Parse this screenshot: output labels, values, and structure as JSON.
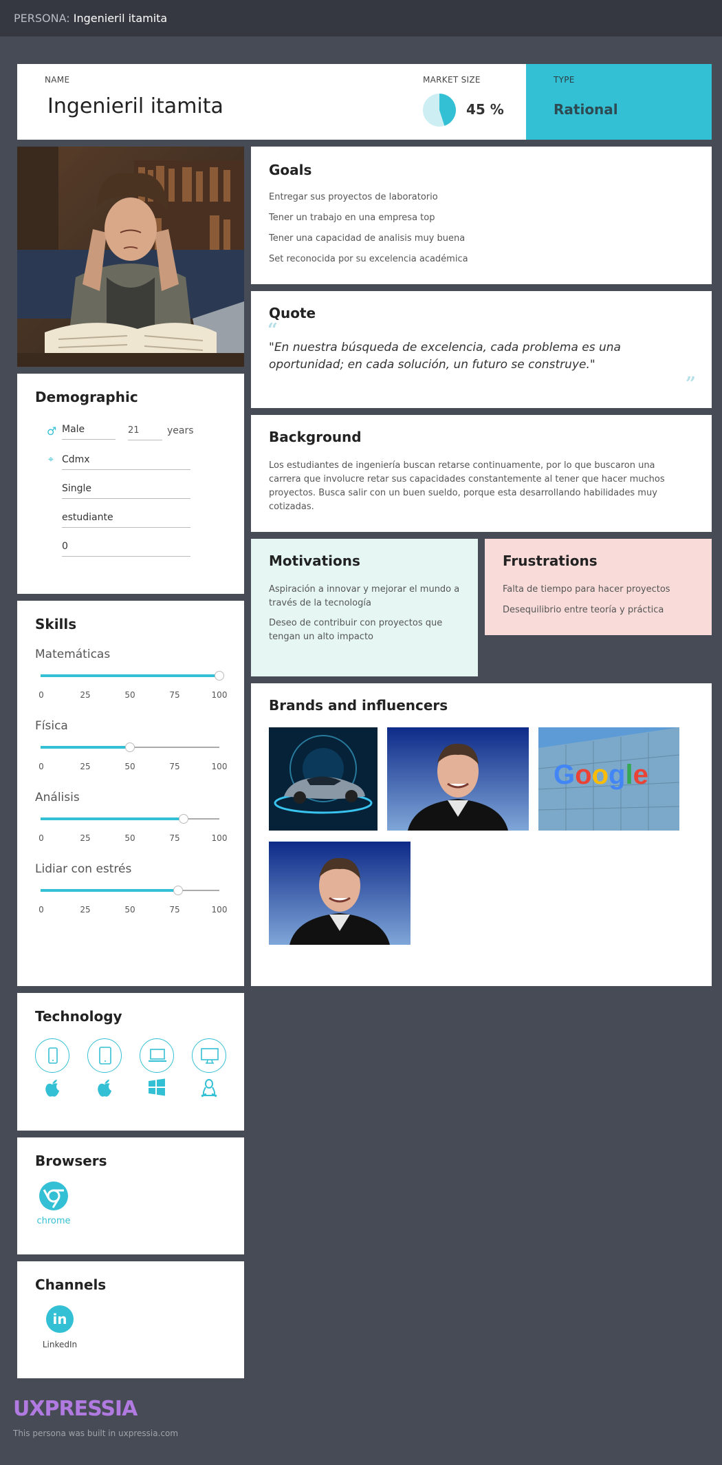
{
  "topbar": {
    "prefix": "PERSONA:",
    "name": "Ingenieril itamita"
  },
  "header": {
    "name_label": "NAME",
    "name": "Ingenieril itamita",
    "market_size_label": "MARKET SIZE",
    "market_size_value": "45 %",
    "market_size_fraction": 0.45,
    "type_label": "TYPE",
    "type": "Rational"
  },
  "demographic": {
    "title": "Demographic",
    "gender": "Male",
    "age": "21",
    "age_unit": "years",
    "location": "Cdmx",
    "status": "Single",
    "occupation": "estudiante",
    "children": "0"
  },
  "skills": {
    "title": "Skills",
    "tick_labels": [
      "0",
      "25",
      "50",
      "75",
      "100"
    ],
    "items": [
      {
        "name": "Matemáticas",
        "value": 100
      },
      {
        "name": "Física",
        "value": 50
      },
      {
        "name": "Análisis",
        "value": 80
      },
      {
        "name": "Lidiar con estrés",
        "value": 77
      }
    ]
  },
  "technology": {
    "title": "Technology",
    "devices": [
      "smartphone-icon",
      "tablet-icon",
      "laptop-icon",
      "desktop-icon"
    ],
    "os": [
      "apple-icon",
      "apple-icon",
      "windows-icon",
      "linux-icon"
    ]
  },
  "browsers": {
    "title": "Browsers",
    "items": [
      "chrome"
    ]
  },
  "channels": {
    "title": "Channels",
    "items": [
      "LinkedIn"
    ]
  },
  "goals": {
    "title": "Goals",
    "items": [
      "Entregar sus proyectos de laboratorio",
      "Tener un trabajo en una empresa top",
      "Tener una capacidad de analisis muy buena",
      "Set reconocida por su excelencia académica"
    ]
  },
  "quote": {
    "title": "Quote",
    "text": "\"En nuestra búsqueda de excelencia, cada problema es una oportunidad; en cada solución, un futuro se construye.\""
  },
  "background": {
    "title": "Background",
    "text": "Los estudiantes de ingeniería buscan retarse continuamente, por lo que buscaron una carrera que involucre retar sus capacidades constantemente al tener que hacer muchos proyectos. Busca salir con un buen sueldo, porque esta desarrollando habilidades muy cotizadas."
  },
  "motivations": {
    "title": "Motivations",
    "items": [
      "Aspiración a innovar y mejorar el mundo a través de la tecnología",
      "Deseo de contribuir con proyectos que tengan un alto impacto"
    ]
  },
  "frustrations": {
    "title": "Frustrations",
    "items": [
      "Falta de tiempo para hacer proyectos",
      "Desequilibrio entre teoría y práctica"
    ]
  },
  "brands": {
    "title": "Brands and influencers",
    "logo_text": "Google"
  },
  "footer": {
    "logo": "UXPRESSIA",
    "credit": "This persona was built in uxpressia.com"
  },
  "colors": {
    "accent": "#34c0d4",
    "background": "#474b55",
    "topbar": "#353840",
    "motivations": "#e6f7f3",
    "frustrations": "#f9dcd9"
  }
}
